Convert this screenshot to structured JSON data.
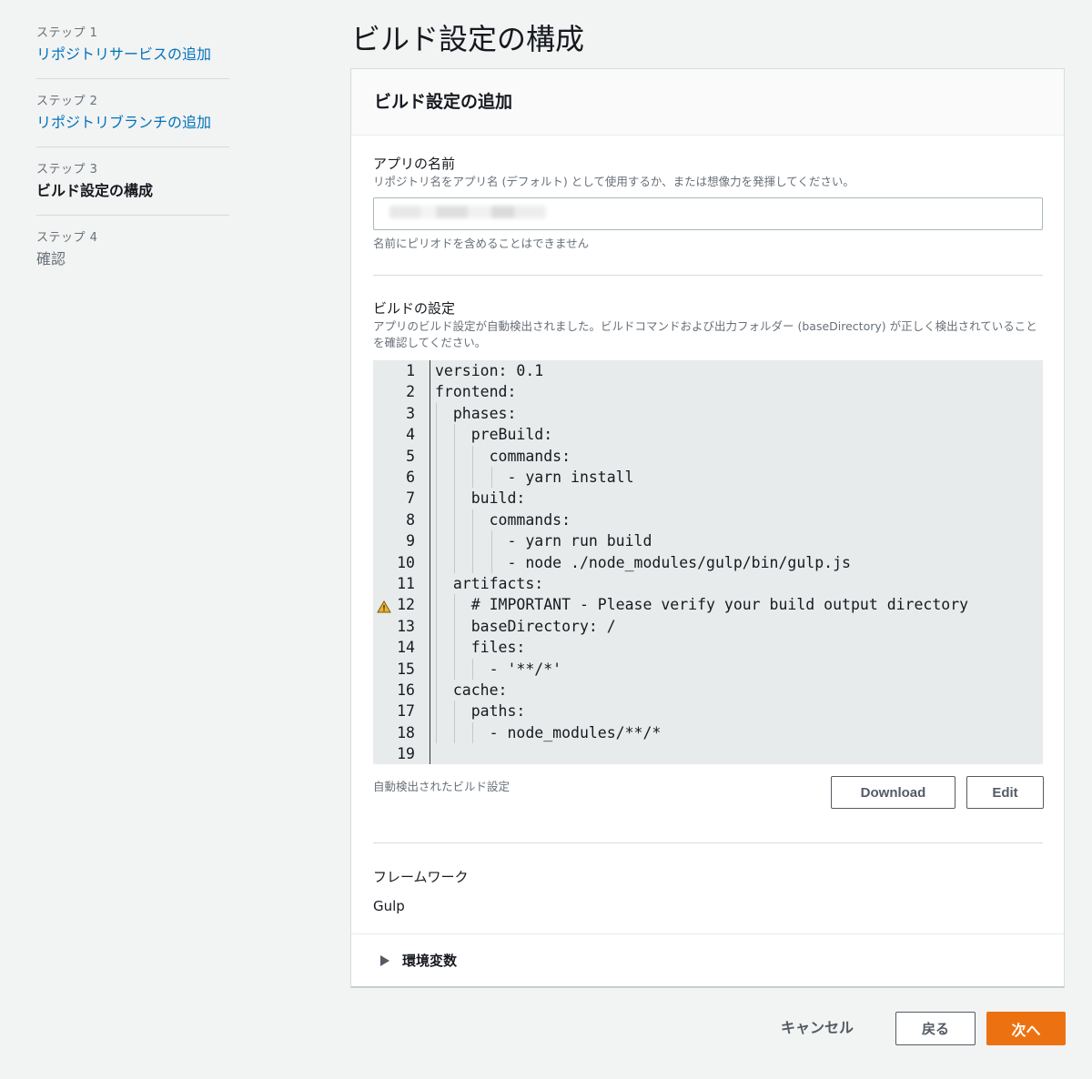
{
  "steps": [
    {
      "num": "ステップ 1",
      "label": "リポジトリサービスの追加",
      "state": "link"
    },
    {
      "num": "ステップ 2",
      "label": "リポジトリブランチの追加",
      "state": "link"
    },
    {
      "num": "ステップ 3",
      "label": "ビルド設定の構成",
      "state": "current"
    },
    {
      "num": "ステップ 4",
      "label": "確認",
      "state": "future"
    }
  ],
  "page_title": "ビルド設定の構成",
  "panel": {
    "title": "ビルド設定の追加",
    "app_name": {
      "label": "アプリの名前",
      "description": "リポジトリ名をアプリ名 (デフォルト) として使用するか、または想像力を発揮してください。",
      "value": "",
      "hint": "名前にピリオドを含めることはできません"
    },
    "build_settings": {
      "label": "ビルドの設定",
      "description": "アプリのビルド設定が自動検出されました。ビルドコマンドおよび出力フォルダー (baseDirectory) が正しく検出されていることを確認してください。",
      "warning_line": 12,
      "lines": [
        "version: 0.1",
        "frontend:",
        "  phases:",
        "    preBuild:",
        "      commands:",
        "        - yarn install",
        "    build:",
        "      commands:",
        "        - yarn run build",
        "        - node ./node_modules/gulp/bin/gulp.js",
        "  artifacts:",
        "    # IMPORTANT - Please verify your build output directory",
        "    baseDirectory: /",
        "    files:",
        "      - '**/*'",
        "  cache:",
        "    paths:",
        "      - node_modules/**/*",
        ""
      ],
      "footer_label": "自動検出されたビルド設定",
      "download_label": "Download",
      "edit_label": "Edit"
    },
    "framework": {
      "label": "フレームワーク",
      "value": "Gulp"
    },
    "env_vars_label": "環境変数"
  },
  "footer": {
    "cancel_label": "キャンセル",
    "back_label": "戻る",
    "next_label": "次へ"
  },
  "colors": {
    "accent": "#ec7211",
    "link": "#0073bb"
  }
}
